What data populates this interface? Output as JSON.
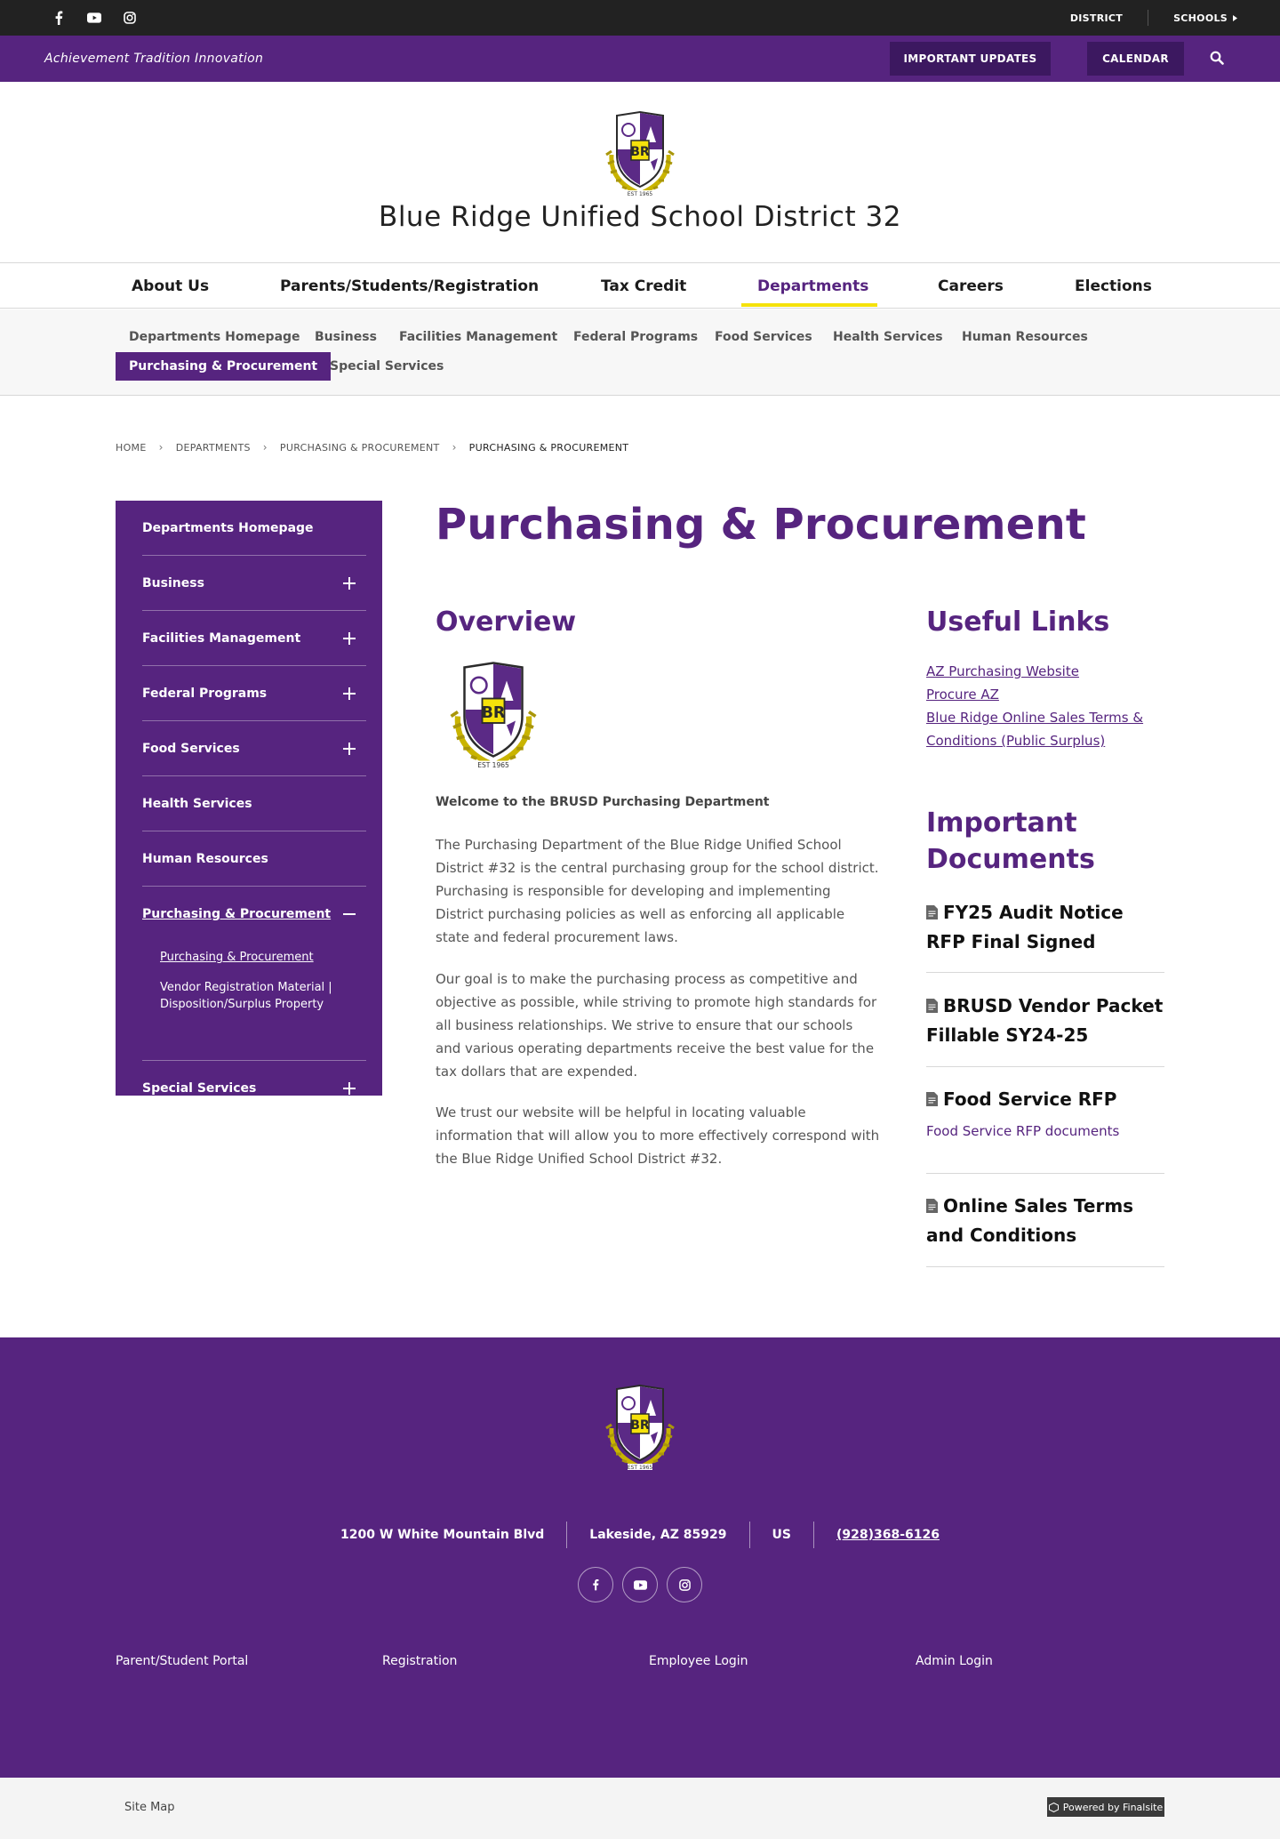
{
  "topbar": {
    "social": [
      "facebook-icon",
      "youtube-icon",
      "instagram-icon"
    ],
    "nav": [
      {
        "label": "DISTRICT"
      },
      {
        "label": "SCHOOLS"
      }
    ]
  },
  "tagbar": {
    "tagline": "Achievement Tradition Innovation",
    "updates_label": "IMPORTANT UPDATES",
    "calendar_label": "CALENDAR"
  },
  "header": {
    "title": "Blue Ridge Unified School District 32",
    "crest_text": "EST 1965",
    "crest_letters": "BR"
  },
  "main_nav": [
    {
      "label": "About Us"
    },
    {
      "label": "Parents/Students/Registration"
    },
    {
      "label": "Tax Credit"
    },
    {
      "label": "Departments"
    },
    {
      "label": "Careers"
    },
    {
      "label": "Elections"
    }
  ],
  "sub_nav": [
    {
      "label": "Departments Homepage"
    },
    {
      "label": "Business"
    },
    {
      "label": "Facilities Management"
    },
    {
      "label": "Federal Programs"
    },
    {
      "label": "Food Services"
    },
    {
      "label": "Health Services"
    },
    {
      "label": "Human Resources"
    },
    {
      "label": "Purchasing & Procurement"
    },
    {
      "label": "Special Services"
    }
  ],
  "breadcrumb": [
    "HOME",
    "DEPARTMENTS",
    "PURCHASING & PROCUREMENT",
    "PURCHASING & PROCUREMENT"
  ],
  "sidebar": {
    "items": [
      {
        "label": "Departments Homepage"
      },
      {
        "label": "Business"
      },
      {
        "label": "Facilities Management"
      },
      {
        "label": "Federal Programs"
      },
      {
        "label": "Food Services"
      },
      {
        "label": "Health Services"
      },
      {
        "label": "Human Resources"
      },
      {
        "label": "Purchasing & Procurement"
      },
      {
        "label": "Special Services"
      }
    ],
    "sub_items": [
      {
        "label": "Purchasing & Procurement"
      },
      {
        "label": "Vendor Registration Material | Disposition/Surplus Property"
      }
    ]
  },
  "content": {
    "page_title": "Purchasing & Procurement",
    "overview_heading": "Overview",
    "welcome": "Welcome to the BRUSD Purchasing Department",
    "paragraphs": [
      "The Purchasing Department of the Blue Ridge Unified School District #32 is the central purchasing group for the school district. Purchasing is responsible for developing and implementing District purchasing policies as well as enforcing all applicable state and federal procurement laws.",
      "Our goal is to make the purchasing process as competitive and objective as possible, while striving to promote high standards for all business relationships.  We strive to ensure that our schools and various operating departments receive the best value for the tax dollars that are expended.",
      "We trust our website will be helpful in locating valuable information that will allow you to more effectively correspond with the Blue Ridge Unified School District #32."
    ]
  },
  "useful_links": {
    "heading": "Useful Links",
    "links": [
      {
        "label": "AZ Purchasing Website"
      },
      {
        "label": "Procure AZ"
      },
      {
        "label": "Blue Ridge Online Sales Terms & Conditions (Public Surplus)"
      }
    ]
  },
  "documents": {
    "heading": "Important Documents",
    "items": [
      {
        "title": "FY25 Audit Notice RFP Final Signed"
      },
      {
        "title": "BRUSD Vendor Packet Fillable SY24-25"
      },
      {
        "title": "Food Service RFP",
        "link": "Food Service RFP documents"
      },
      {
        "title": "Online Sales Terms and Conditions"
      }
    ]
  },
  "footer": {
    "street": "1200 W White Mountain Blvd",
    "city": "Lakeside, AZ  85929",
    "country": "US",
    "phone": "(928)368-6126",
    "links": [
      {
        "label": "Parent/Student Portal"
      },
      {
        "label": "Registration"
      },
      {
        "label": "Employee Login"
      },
      {
        "label": "Admin Login"
      }
    ]
  },
  "bottom": {
    "sitemap": "Site Map",
    "powered": "Powered by Finalsite"
  },
  "colors": {
    "brand_purple": "#56247f",
    "dark_purple": "#3c1860",
    "accent_yellow": "#f5e20b",
    "topbar": "#222222"
  }
}
